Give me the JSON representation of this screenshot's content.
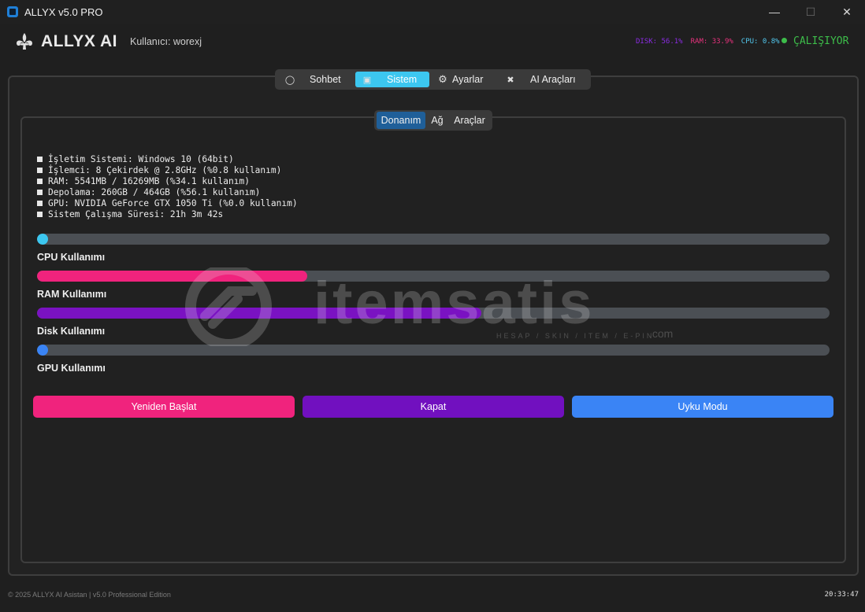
{
  "window": {
    "title": "ALLYX v5.0 PRO",
    "minimize_icon": "minimize-icon",
    "maximize_icon": "maximize-icon",
    "close_icon": "close-icon"
  },
  "header": {
    "logo_icon": "fleur-de-lis-icon",
    "app_name": "ALLYX AI",
    "user_label": "Kullanıcı: worexj",
    "stats": {
      "disk": "DISK: 56.1%",
      "ram": "RAM: 33.9%",
      "cpu": "CPU: 0.8%"
    },
    "status": "ÇALIŞIYOR"
  },
  "main_tabs": [
    {
      "label": "Sohbet",
      "icon": "chat-bubble-icon",
      "active": false
    },
    {
      "label": "Sistem",
      "icon": "monitor-icon",
      "active": true
    },
    {
      "label": "Ayarlar",
      "icon": "gear-icon",
      "active": false
    },
    {
      "label": "AI Araçları",
      "icon": "tools-icon",
      "active": false
    }
  ],
  "sub_tabs": [
    {
      "label": "Donanım",
      "active": true
    },
    {
      "label": "Ağ",
      "active": false
    },
    {
      "label": "Araçlar",
      "active": false
    }
  ],
  "system_info": [
    "İşletim Sistemi: Windows 10 (64bit)",
    "İşlemci: 8 Çekirdek @ 2.8GHz (%0.8 kullanım)",
    "RAM: 5541MB / 16269MB (%34.1 kullanım)",
    "Depolama: 260GB / 464GB (%56.1 kullanım)",
    "GPU: NVIDIA GeForce GTX 1050 Ti (%0.0 kullanım)",
    "Sistem Çalışma Süresi: 21h 3m 42s"
  ],
  "usage_bars": {
    "cpu": {
      "label": "CPU Kullanımı",
      "percent": 0.8,
      "color": "#3cc7f0"
    },
    "ram": {
      "label": "RAM Kullanımı",
      "percent": 34.1,
      "color": "#f0237d"
    },
    "disk": {
      "label": "Disk Kullanımı",
      "percent": 56.1,
      "color": "#7a12c2"
    },
    "gpu": {
      "label": "GPU Kullanımı",
      "percent": 0.0,
      "color": "#3a84f5"
    }
  },
  "buttons": {
    "restart": {
      "label": "Yeniden Başlat",
      "color": "#f0237d"
    },
    "shutdown": {
      "label": "Kapat",
      "color": "#7110bf"
    },
    "sleep": {
      "label": "Uyku Modu",
      "color": "#3a84f5"
    }
  },
  "watermark": {
    "brand": "itemsatis",
    "tagline": "HESAP / SKIN / ITEM / E-PIN",
    "domain": ".com"
  },
  "footer": {
    "copyright": "© 2025 ALLYX AI Asistan | v5.0 Professional Edition",
    "time": "20:33:47"
  }
}
